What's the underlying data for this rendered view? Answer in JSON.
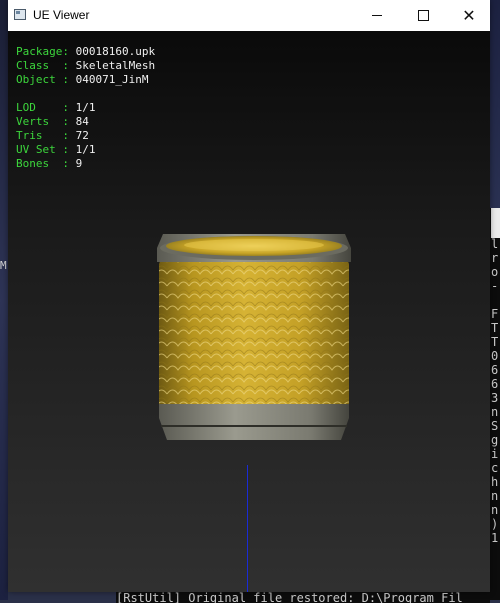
{
  "window": {
    "title": "UE Viewer",
    "controls": {
      "minimize": "minimize",
      "maximize": "maximize",
      "close": "close"
    }
  },
  "info": {
    "package": {
      "key": "Package: ",
      "value": "00018160.upk"
    },
    "class": {
      "key": "Class  : ",
      "value": "SkeletalMesh"
    },
    "object": {
      "key": "Object : ",
      "value": "040071_JinM"
    },
    "lod": {
      "key": "LOD    : ",
      "value": "1/1"
    },
    "verts": {
      "key": "Verts  : ",
      "value": "84"
    },
    "tris": {
      "key": "Tris   : ",
      "value": "72"
    },
    "uvset": {
      "key": "UV Set : ",
      "value": "1/1"
    },
    "bones": {
      "key": "Bones  : ",
      "value": "9"
    }
  },
  "background": {
    "left_char": "M",
    "console_right_lines": [
      "l",
      "r",
      "o",
      "-",
      "",
      "F",
      "T",
      "T",
      "0",
      "6",
      "6",
      "3",
      "n",
      "S",
      "g",
      "i",
      "c",
      "h",
      "n",
      "n",
      ")",
      "1"
    ],
    "console_bottom": "[RstUtil] Original file restored: D:\\Program Fil"
  },
  "colors": {
    "label_green": "#3cd63c",
    "value_white": "#f0f0f0",
    "axis_blue": "#1a2bd6",
    "mesh_gold": "#c9a526"
  },
  "icons": {
    "app": "app-window-icon"
  }
}
